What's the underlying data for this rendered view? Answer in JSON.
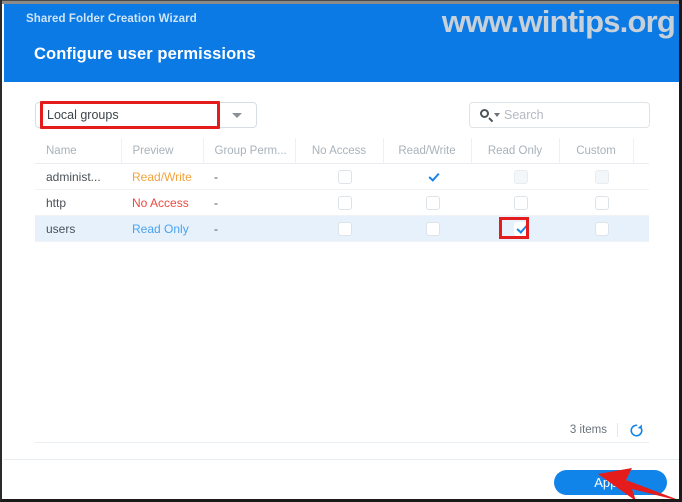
{
  "window": {
    "wizard_title": "Shared Folder Creation Wizard",
    "page_title": "Configure user permissions",
    "watermark": "www.wintips.org",
    "header_color": "#0b7ae5"
  },
  "toolbar": {
    "dropdown": {
      "selected": "Local groups",
      "caret_icon": "chevron-down-icon"
    },
    "search": {
      "placeholder": "Search",
      "icon": "search-icon",
      "caret_icon": "chevron-down-icon"
    }
  },
  "table": {
    "columns": [
      "Name",
      "Preview",
      "Group Perm...",
      "No Access",
      "Read/Write",
      "Read Only",
      "Custom",
      ""
    ],
    "rows": [
      {
        "name": "administ...",
        "preview": "Read/Write",
        "preview_color": "#f5a33c",
        "group_perm": "-",
        "no_access": false,
        "read_write": true,
        "read_only": false,
        "custom": false,
        "no_access_disabled": false,
        "read_only_disabled": true,
        "custom_disabled": true,
        "selected": false
      },
      {
        "name": "http",
        "preview": "No Access",
        "preview_color": "#ec4a3f",
        "group_perm": "-",
        "no_access": false,
        "read_write": false,
        "read_only": false,
        "custom": false,
        "no_access_disabled": false,
        "read_only_disabled": false,
        "custom_disabled": false,
        "selected": false
      },
      {
        "name": "users",
        "preview": "Read Only",
        "preview_color": "#4aa3f0",
        "group_perm": "-",
        "no_access": false,
        "read_write": false,
        "read_only": true,
        "custom": false,
        "no_access_disabled": false,
        "read_only_disabled": false,
        "custom_disabled": false,
        "selected": true
      }
    ]
  },
  "status": {
    "items_count": "3 items",
    "refresh_icon": "refresh-icon"
  },
  "footer": {
    "apply_label": "Apply",
    "apply_color": "#1184ea"
  },
  "annotations": {
    "dropdown_highlight_color": "#e51c1c",
    "checkbox_highlight_color": "#e51c1c",
    "arrow_color": "#e51c1c"
  }
}
